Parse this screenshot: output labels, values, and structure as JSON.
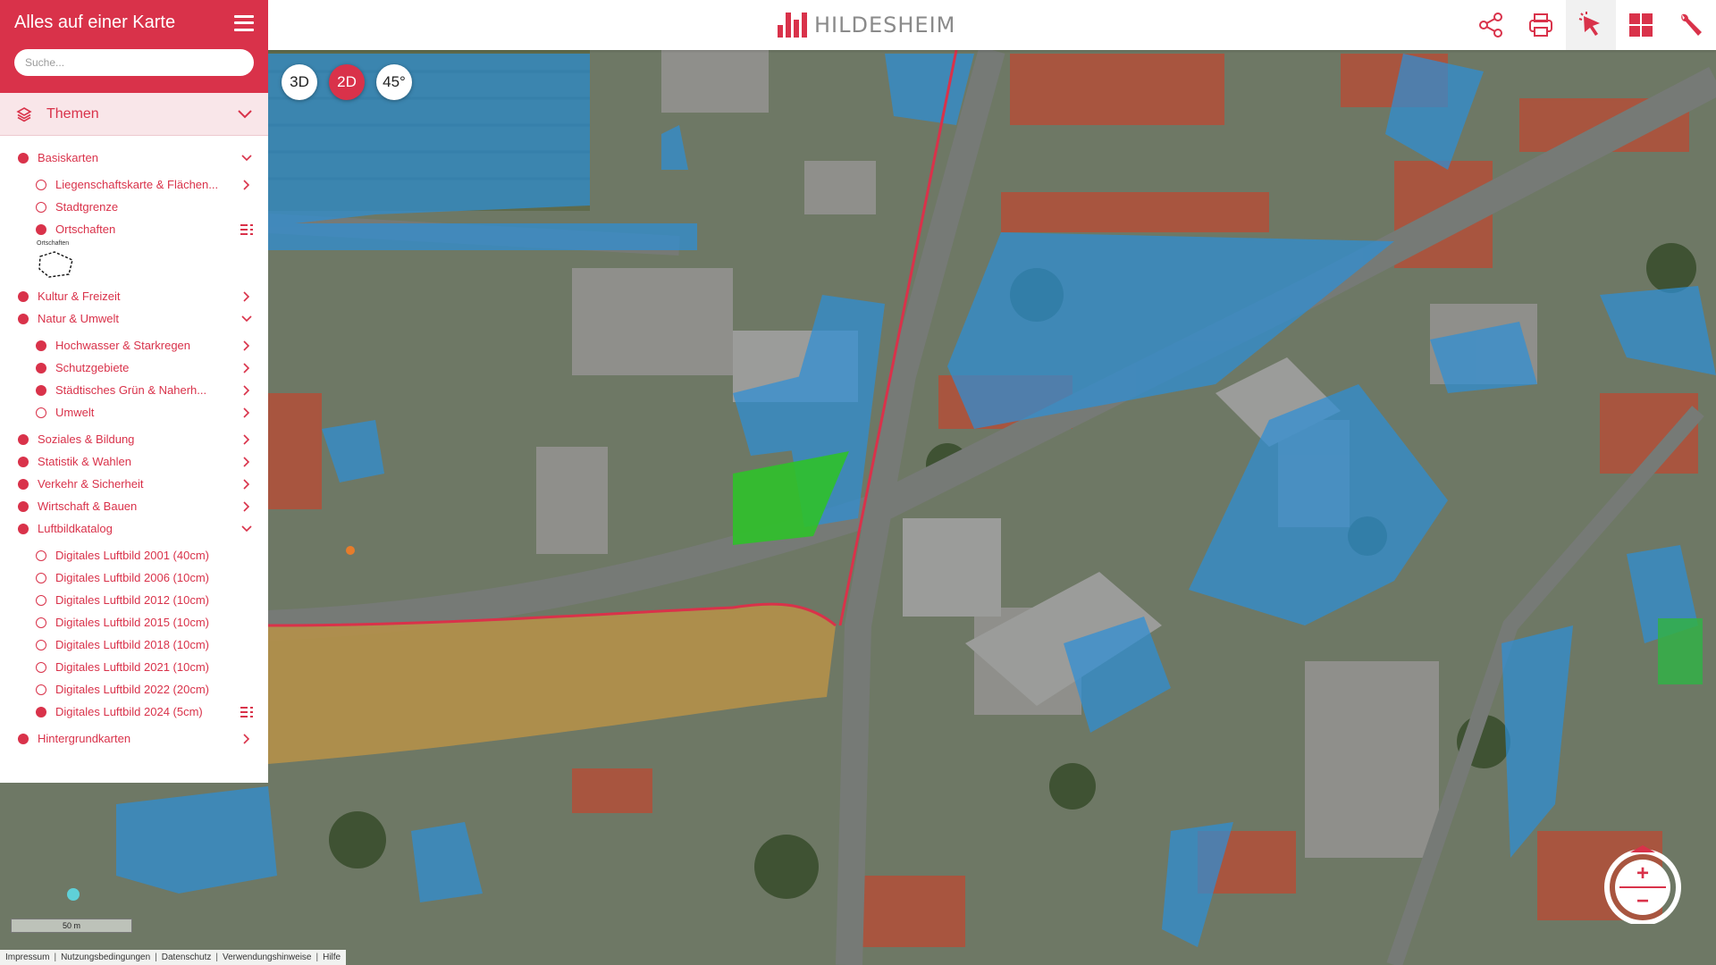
{
  "app": {
    "title": "Alles auf einer Karte",
    "search_placeholder": "Suche..."
  },
  "brand": {
    "text": "HILDESHEIM",
    "color": "#d9324a"
  },
  "accent": "#d9324a",
  "themen": {
    "label": "Themen"
  },
  "toolbar": [
    "share-icon",
    "print-icon",
    "info-click-icon",
    "apps-icon",
    "tools-icon"
  ],
  "view_buttons": {
    "three_d": "3D",
    "two_d": "2D",
    "tilt": "45°",
    "active": "2D"
  },
  "layers": {
    "basiskarten": "Basiskarten",
    "liegenschaft": "Liegenschaftskarte & Flächen...",
    "stadtgrenze": "Stadtgrenze",
    "ortschaften": "Ortschaften",
    "ortschaften_legend": "Ortschaften",
    "kultur": "Kultur & Freizeit",
    "natur": "Natur & Umwelt",
    "hochwasser": "Hochwasser & Starkregen",
    "schutzgebiete": "Schutzgebiete",
    "gruen": "Städtisches Grün & Naherh...",
    "umwelt": "Umwelt",
    "soziales": "Soziales & Bildung",
    "statistik": "Statistik & Wahlen",
    "verkehr": "Verkehr & Sicherheit",
    "wirtschaft": "Wirtschaft & Bauen",
    "luftbild": "Luftbildkatalog",
    "lb2001": "Digitales Luftbild 2001 (40cm)",
    "lb2006": "Digitales Luftbild 2006 (10cm)",
    "lb2012": "Digitales Luftbild 2012 (10cm)",
    "lb2015": "Digitales Luftbild 2015 (10cm)",
    "lb2018": "Digitales Luftbild 2018 (10cm)",
    "lb2021": "Digitales Luftbild 2021 (10cm)",
    "lb2022": "Digitales Luftbild 2022 (20cm)",
    "lb2024": "Digitales Luftbild 2024 (5cm)",
    "hintergrund": "Hintergrundkarten"
  },
  "zoom": {
    "in": "+",
    "out": "−"
  },
  "scale": {
    "label": "50 m"
  },
  "footer": {
    "impressum": "Impressum",
    "nutzung": "Nutzungsbedingungen",
    "datenschutz": "Datenschutz",
    "hinweise": "Verwendungshinweise",
    "hilfe": "Hilfe"
  }
}
